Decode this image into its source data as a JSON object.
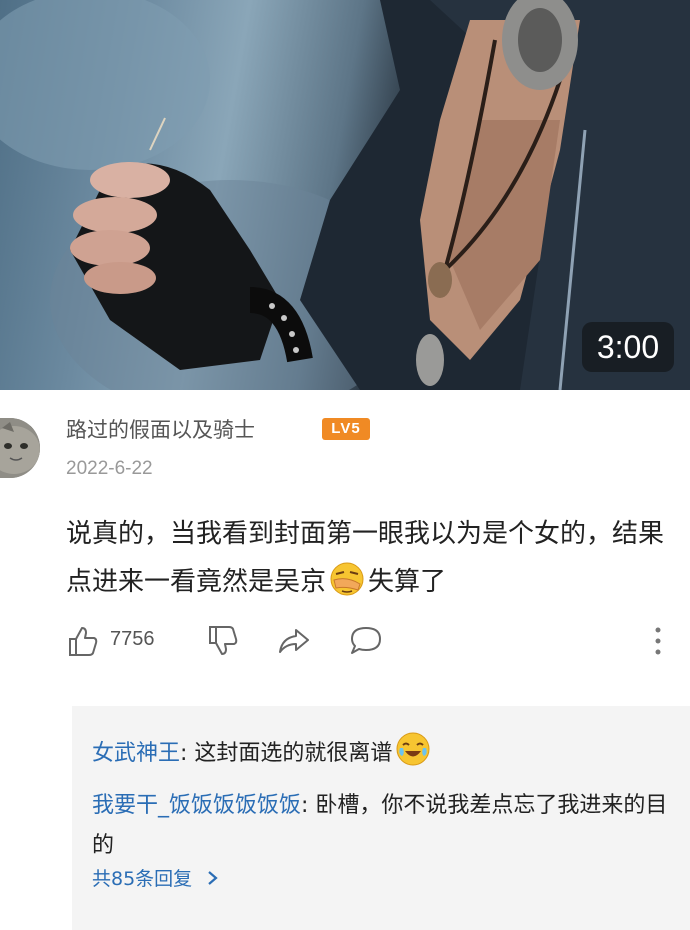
{
  "video": {
    "duration": "3:00"
  },
  "comment": {
    "username": "路过的假面以及骑士",
    "level_badge": "LV5",
    "date": "2022-6-22",
    "text_part1": "说真的，当我看到封面第一眼我以为是个女的，结果点进来一看竟然是吴京",
    "emoji": "facepalm-emoji",
    "text_part2": "失算了",
    "like_count": "7756"
  },
  "replies": {
    "items": [
      {
        "name": "女武神王",
        "separator": ":",
        "text": " 这封面选的就很离谱",
        "emoji": "laugh-cry-emoji"
      },
      {
        "name": "我要干_饭饭饭饭饭饭",
        "separator": ":",
        "text": " 卧槽，你不说我差点忘了我进来的目的"
      }
    ],
    "more_label": "共85条回复",
    "more_icon": "chevron-right-icon"
  },
  "colors": {
    "link_blue": "#2a6db5",
    "badge_orange": "#f08a24",
    "reply_bg": "#f4f4f4"
  }
}
